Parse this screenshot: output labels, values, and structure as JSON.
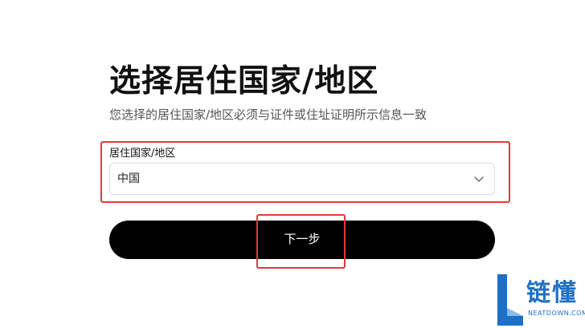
{
  "form": {
    "title": "选择居住国家/地区",
    "subtitle": "您选择的居住国家/地区必须与证件或住址证明所示信息一致",
    "country_field": {
      "label": "居住国家/地区",
      "value": "中国"
    },
    "next_label": "下一步"
  },
  "watermark": {
    "text": "链懂",
    "sub": "NEATDOWN.COM"
  },
  "colors": {
    "highlight": "#e53935",
    "button": "#000000",
    "watermark": "#1f6fc4"
  }
}
